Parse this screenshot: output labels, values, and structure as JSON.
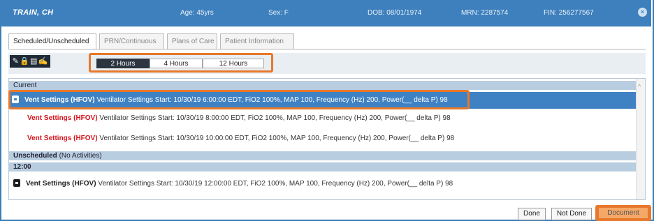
{
  "patient_bar": {
    "name": "TRAIN, CH",
    "age": "Age: 45yrs",
    "sex": "Sex: F",
    "dob": "DOB: 08/01/1974",
    "mrn": "MRN: 2287574",
    "fin": "FIN: 256277567",
    "close_glyph": "×"
  },
  "tabs": [
    {
      "label": "Scheduled/Unscheduled",
      "active": true
    },
    {
      "label": "PRN/Continuous",
      "active": false
    },
    {
      "label": "Plans of Care",
      "active": false
    },
    {
      "label": "Patient Information",
      "active": false
    }
  ],
  "toolbar": {
    "icons": [
      "pencil-icon",
      "lock-icon",
      "clipboard-icon",
      "edit-form-icon"
    ],
    "icon_glyphs": [
      "✎",
      "🔒",
      "▤",
      "✍"
    ],
    "ranges": [
      {
        "label": "2 Hours",
        "active": true
      },
      {
        "label": "4 Hours",
        "active": false
      },
      {
        "label": "12 Hours",
        "active": false
      }
    ]
  },
  "grid": {
    "current_header": "Current",
    "rows": [
      {
        "task": "Vent Settings (HFOV)",
        "detail": " Ventilator Settings Start: 10/30/19 6:00:00 EDT, FiO2 100%, MAP 100, Frequency (Hz) 200, Power(__ delta P) 98",
        "selected": true
      },
      {
        "task": "Vent Settings (HFOV)",
        "detail": " Ventilator Settings Start: 10/30/19 8:00:00 EDT, FiO2 100%, MAP 100, Frequency (Hz) 200, Power(__ delta P) 98",
        "selected": false
      },
      {
        "task": "Vent Settings (HFOV)",
        "detail": " Ventilator Settings Start: 10/30/19 10:00:00 EDT, FiO2 100%, MAP 100, Frequency (Hz) 200, Power(__ delta P) 98",
        "selected": false
      }
    ],
    "unscheduled_header_bold": "Unscheduled",
    "unscheduled_header_rest": " (No Activities)",
    "time_header": "12:00",
    "time_row": {
      "task": "Vent Settings (HFOV)",
      "detail": " Ventilator Settings Start: 10/30/19 12:00:00 EDT, FiO2 100%, MAP 100, Frequency (Hz) 200, Power(__ delta P) 98"
    }
  },
  "buttons": {
    "done": "Done",
    "not_done": "Not Done",
    "document": "Document"
  },
  "colors": {
    "titlebar": "#3e80bd",
    "selection": "#3f82c4",
    "highlight_orange": "#e8782b",
    "task_red": "#d4141c"
  }
}
